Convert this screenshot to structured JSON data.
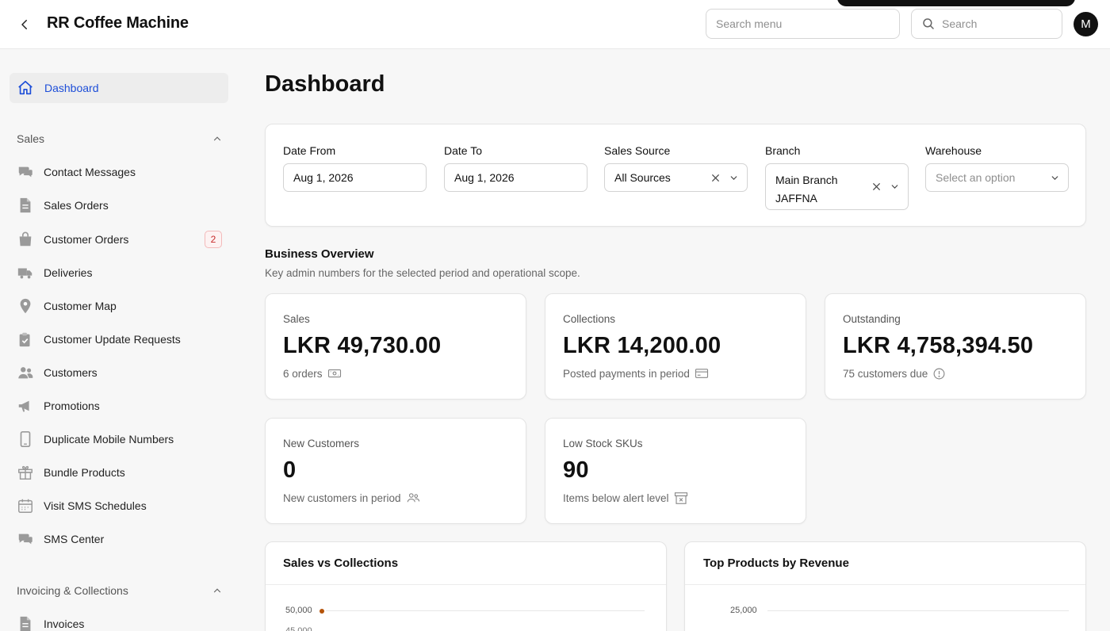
{
  "header": {
    "app_title": "RR Coffee Machine",
    "search_menu_placeholder": "Search menu",
    "search_placeholder": "Search",
    "avatar_initial": "M"
  },
  "sidebar": {
    "active_item": "Dashboard",
    "sections": [
      {
        "title": "Sales",
        "items": [
          {
            "label": "Contact Messages",
            "icon": "chat-bubbles-icon"
          },
          {
            "label": "Sales Orders",
            "icon": "document-icon"
          },
          {
            "label": "Customer Orders",
            "icon": "shopping-bag-icon",
            "badge": "2"
          },
          {
            "label": "Deliveries",
            "icon": "truck-icon"
          },
          {
            "label": "Customer Map",
            "icon": "map-pin-icon"
          },
          {
            "label": "Customer Update Requests",
            "icon": "clipboard-check-icon"
          },
          {
            "label": "Customers",
            "icon": "users-icon"
          },
          {
            "label": "Promotions",
            "icon": "megaphone-icon"
          },
          {
            "label": "Duplicate Mobile Numbers",
            "icon": "mobile-phone-icon"
          },
          {
            "label": "Bundle Products",
            "icon": "gift-icon"
          },
          {
            "label": "Visit SMS Schedules",
            "icon": "calendar-icon"
          },
          {
            "label": "SMS Center",
            "icon": "chat-bubbles-icon"
          }
        ]
      },
      {
        "title": "Invoicing & Collections",
        "items": [
          {
            "label": "Invoices",
            "icon": "document-icon"
          }
        ]
      }
    ]
  },
  "main": {
    "page_title": "Dashboard",
    "filters": {
      "date_from": {
        "label": "Date From",
        "value": "Aug 1, 2026"
      },
      "date_to": {
        "label": "Date To",
        "value": "Aug 1, 2026"
      },
      "sales_source": {
        "label": "Sales Source",
        "value": "All Sources"
      },
      "branch": {
        "label": "Branch",
        "value_line1": "Main Branch",
        "value_line2": "JAFFNA"
      },
      "warehouse": {
        "label": "Warehouse",
        "placeholder": "Select an option"
      }
    },
    "overview": {
      "title": "Business Overview",
      "subtitle": "Key admin numbers for the selected period and operational scope.",
      "stats": [
        {
          "label": "Sales",
          "value": "LKR 49,730.00",
          "sub": "6 orders",
          "icon": "banknote-icon"
        },
        {
          "label": "Collections",
          "value": "LKR 14,200.00",
          "sub": "Posted payments in period",
          "icon": "credit-card-icon"
        },
        {
          "label": "Outstanding",
          "value": "LKR 4,758,394.50",
          "sub": "75 customers due",
          "icon": "alert-circle-icon"
        },
        {
          "label": "New Customers",
          "value": "0",
          "sub": "New customers in period",
          "icon": "users-icon"
        },
        {
          "label": "Low Stock SKUs",
          "value": "90",
          "sub": "Items below alert level",
          "icon": "archive-x-icon"
        }
      ]
    },
    "charts": {
      "sales_vs_collections": {
        "title": "Sales vs Collections"
      },
      "top_products": {
        "title": "Top Products by Revenue"
      }
    }
  },
  "chart_data": [
    {
      "type": "line",
      "title": "Sales vs Collections",
      "y_ticks_visible": [
        "50,000"
      ],
      "point_color": "#b45309"
    },
    {
      "type": "bar",
      "title": "Top Products by Revenue",
      "y_ticks_visible": [
        "25,000"
      ]
    }
  ]
}
